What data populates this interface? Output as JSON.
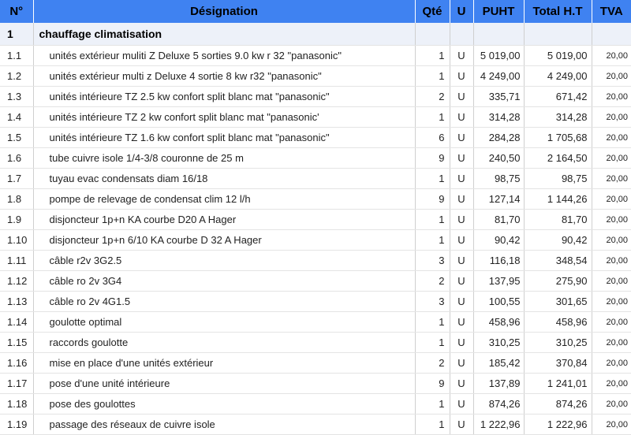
{
  "headers": {
    "num": "N°",
    "designation": "Désignation",
    "qte": "Qté",
    "u": "U",
    "puht": "PUHT",
    "total_ht": "Total H.T",
    "tva": "TVA"
  },
  "section": {
    "num": "1",
    "title": "chauffage climatisation"
  },
  "rows": [
    {
      "num": "1.1",
      "designation": "unités extérieur muliti Z Deluxe 5 sorties 9.0 kw r 32  \"panasonic\"",
      "qte": "1",
      "u": "U",
      "puht": "5 019,00",
      "total_ht": "5 019,00",
      "tva": "20,00"
    },
    {
      "num": "1.2",
      "designation": "unités extérieur multi z Deluxe 4 sortie 8 kw r32 \"panasonic\"",
      "qte": "1",
      "u": "U",
      "puht": "4 249,00",
      "total_ht": "4 249,00",
      "tva": "20,00"
    },
    {
      "num": "1.3",
      "designation": "unités intérieure TZ 2.5 kw confort split blanc mat \"panasonic\"",
      "qte": "2",
      "u": "U",
      "puht": "335,71",
      "total_ht": "671,42",
      "tva": "20,00"
    },
    {
      "num": "1.4",
      "designation": "unités intérieure TZ  2 kw confort split blanc mat \"panasonic'",
      "qte": "1",
      "u": "U",
      "puht": "314,28",
      "total_ht": "314,28",
      "tva": "20,00"
    },
    {
      "num": "1.5",
      "designation": "unités intérieure TZ 1.6 kw confort split blanc mat \"panasonic\"",
      "qte": "6",
      "u": "U",
      "puht": "284,28",
      "total_ht": "1 705,68",
      "tva": "20,00"
    },
    {
      "num": "1.6",
      "designation": "tube cuivre isole 1/4-3/8 couronne de 25 m",
      "qte": "9",
      "u": "U",
      "puht": "240,50",
      "total_ht": "2 164,50",
      "tva": "20,00"
    },
    {
      "num": "1.7",
      "designation": "tuyau evac condensats diam 16/18",
      "qte": "1",
      "u": "U",
      "puht": "98,75",
      "total_ht": "98,75",
      "tva": "20,00"
    },
    {
      "num": "1.8",
      "designation": "pompe de relevage de condensat clim 12 l/h",
      "qte": "9",
      "u": "U",
      "puht": "127,14",
      "total_ht": "1 144,26",
      "tva": "20,00"
    },
    {
      "num": "1.9",
      "designation": "disjoncteur 1p+n KA courbe D20 A Hager",
      "qte": "1",
      "u": "U",
      "puht": "81,70",
      "total_ht": "81,70",
      "tva": "20,00"
    },
    {
      "num": "1.10",
      "designation": "disjoncteur 1p+n 6/10 KA courbe D 32 A  Hager",
      "qte": "1",
      "u": "U",
      "puht": "90,42",
      "total_ht": "90,42",
      "tva": "20,00"
    },
    {
      "num": "1.11",
      "designation": "câble r2v 3G2.5",
      "qte": "3",
      "u": "U",
      "puht": "116,18",
      "total_ht": "348,54",
      "tva": "20,00"
    },
    {
      "num": "1.12",
      "designation": "câble ro 2v 3G4",
      "qte": "2",
      "u": "U",
      "puht": "137,95",
      "total_ht": "275,90",
      "tva": "20,00"
    },
    {
      "num": "1.13",
      "designation": "câble ro 2v 4G1.5",
      "qte": "3",
      "u": "U",
      "puht": "100,55",
      "total_ht": "301,65",
      "tva": "20,00"
    },
    {
      "num": "1.14",
      "designation": "goulotte optimal",
      "qte": "1",
      "u": "U",
      "puht": "458,96",
      "total_ht": "458,96",
      "tva": "20,00"
    },
    {
      "num": "1.15",
      "designation": "raccords goulotte",
      "qte": "1",
      "u": "U",
      "puht": "310,25",
      "total_ht": "310,25",
      "tva": "20,00"
    },
    {
      "num": "1.16",
      "designation": "mise en place d'une  unités extérieur",
      "qte": "2",
      "u": "U",
      "puht": "185,42",
      "total_ht": "370,84",
      "tva": "20,00"
    },
    {
      "num": "1.17",
      "designation": "pose d'une unité intérieure",
      "qte": "9",
      "u": "U",
      "puht": "137,89",
      "total_ht": "1 241,01",
      "tva": "20,00"
    },
    {
      "num": "1.18",
      "designation": "pose des goulottes",
      "qte": "1",
      "u": "U",
      "puht": "874,26",
      "total_ht": "874,26",
      "tva": "20,00"
    },
    {
      "num": "1.19",
      "designation": "passage des réseaux de cuivre isole",
      "qte": "1",
      "u": "U",
      "puht": "1 222,96",
      "total_ht": "1 222,96",
      "tva": "20,00"
    }
  ]
}
